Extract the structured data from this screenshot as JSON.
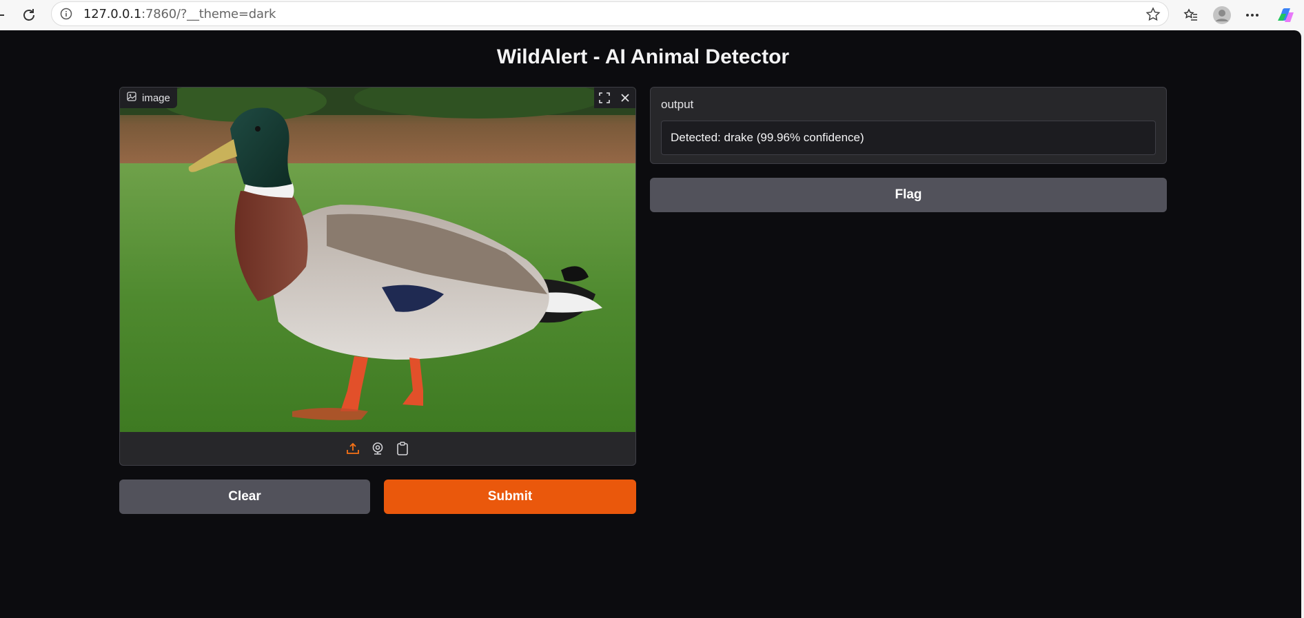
{
  "browser": {
    "url_host": "127.0.0.1",
    "url_rest": ":7860/?__theme=dark"
  },
  "page": {
    "title": "WildAlert - AI Animal Detector"
  },
  "image_input": {
    "label": "image",
    "upload_source_active": "upload"
  },
  "buttons": {
    "clear": "Clear",
    "submit": "Submit",
    "flag": "Flag"
  },
  "output": {
    "label": "output",
    "value": "Detected: drake (99.96% confidence)"
  },
  "colors": {
    "page_bg": "#0c0c0f",
    "panel_bg": "#27272a",
    "primary": "#ea580c",
    "secondary": "#52525b"
  }
}
